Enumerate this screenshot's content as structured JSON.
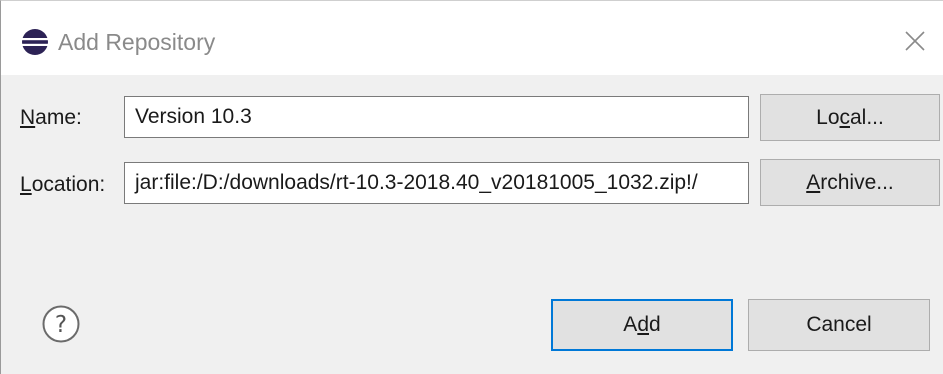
{
  "window": {
    "title": "Add Repository",
    "title_icon": "eclipse-logo-icon",
    "close_icon": "close-icon"
  },
  "form": {
    "name_label_key": "N",
    "name_label_rest": "ame:",
    "name_value": "Version 10.3",
    "location_label_key": "L",
    "location_label_rest": "ocation:",
    "location_value": "jar:file:/D:/downloads/rt-10.3-2018.40_v20181005_1032.zip!/"
  },
  "buttons": {
    "local_pre": "Lo",
    "local_key": "c",
    "local_post": "al...",
    "archive_key": "A",
    "archive_post": "rchive...",
    "add_pre": "A",
    "add_key": "d",
    "add_post": "d",
    "cancel_label": "Cancel"
  },
  "footer": {
    "help_icon": "help-question-icon"
  },
  "colors": {
    "accent": "#0078d7",
    "button_bg": "#e1e1e1",
    "dialog_bg": "#f0f0f0"
  }
}
